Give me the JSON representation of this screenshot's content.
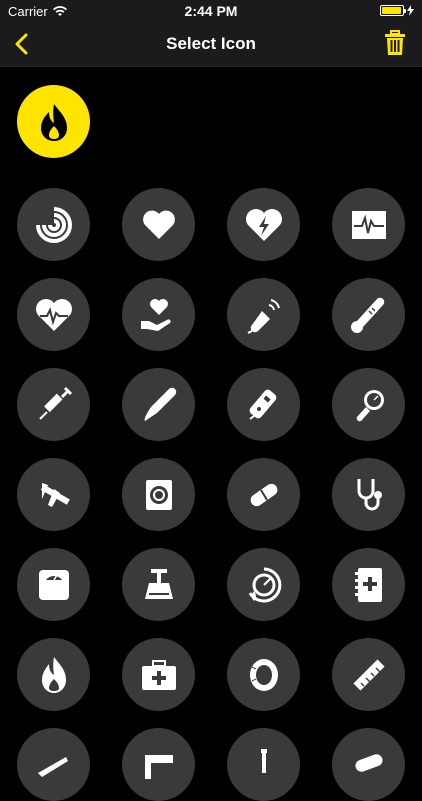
{
  "status": {
    "carrier": "Carrier",
    "time": "2:44 PM"
  },
  "nav": {
    "title": "Select Icon"
  },
  "colors": {
    "accent": "#ffe400",
    "cell_bg": "#3a3a3a",
    "bar_bg": "#1b1b1b"
  },
  "selected_icon": "flame-icon",
  "icons": [
    "pulse-rings-icon",
    "heart-icon",
    "heart-bolt-icon",
    "ecg-monitor-icon",
    "heart-ecg-icon",
    "hand-heart-icon",
    "ultrasound-probe-icon",
    "thermometer-icon",
    "syringe-icon",
    "scalpel-icon",
    "glucose-meter-icon",
    "blood-pressure-gauge-icon",
    "caliper-icon",
    "condom-icon",
    "pill-capsule-icon",
    "stethoscope-icon",
    "bathroom-scale-icon",
    "weighing-scale-icon",
    "drop-gauge-icon",
    "medical-book-icon",
    "flame-icon",
    "first-aid-kit-icon",
    "measuring-tape-icon",
    "ruler-icon",
    "knife-icon",
    "sewing-machine-icon",
    "microscope-icon",
    "bandage-icon"
  ]
}
